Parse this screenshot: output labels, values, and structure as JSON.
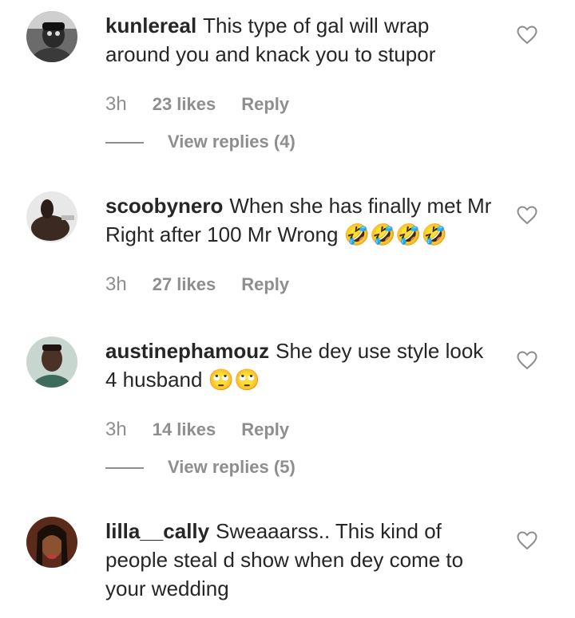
{
  "comments": [
    {
      "username": "kunlereal",
      "text": "This type of gal will wrap around you and knack you to stupor",
      "time": "3h",
      "likes": "23 likes",
      "reply_label": "Reply",
      "view_replies": "View replies (4)"
    },
    {
      "username": "scoobynero",
      "text": "When she has finally met Mr Right after 100 Mr Wrong 🤣🤣🤣🤣",
      "time": "3h",
      "likes": "27 likes",
      "reply_label": "Reply"
    },
    {
      "username": "austinephamouz",
      "text": "She dey use style look 4 husband 🙄🙄",
      "time": "3h",
      "likes": "14 likes",
      "reply_label": "Reply",
      "view_replies": "View replies (5)"
    },
    {
      "username": "lilla__cally",
      "text": "Sweaaarss.. This kind of people steal d show when dey come to your wedding"
    }
  ]
}
